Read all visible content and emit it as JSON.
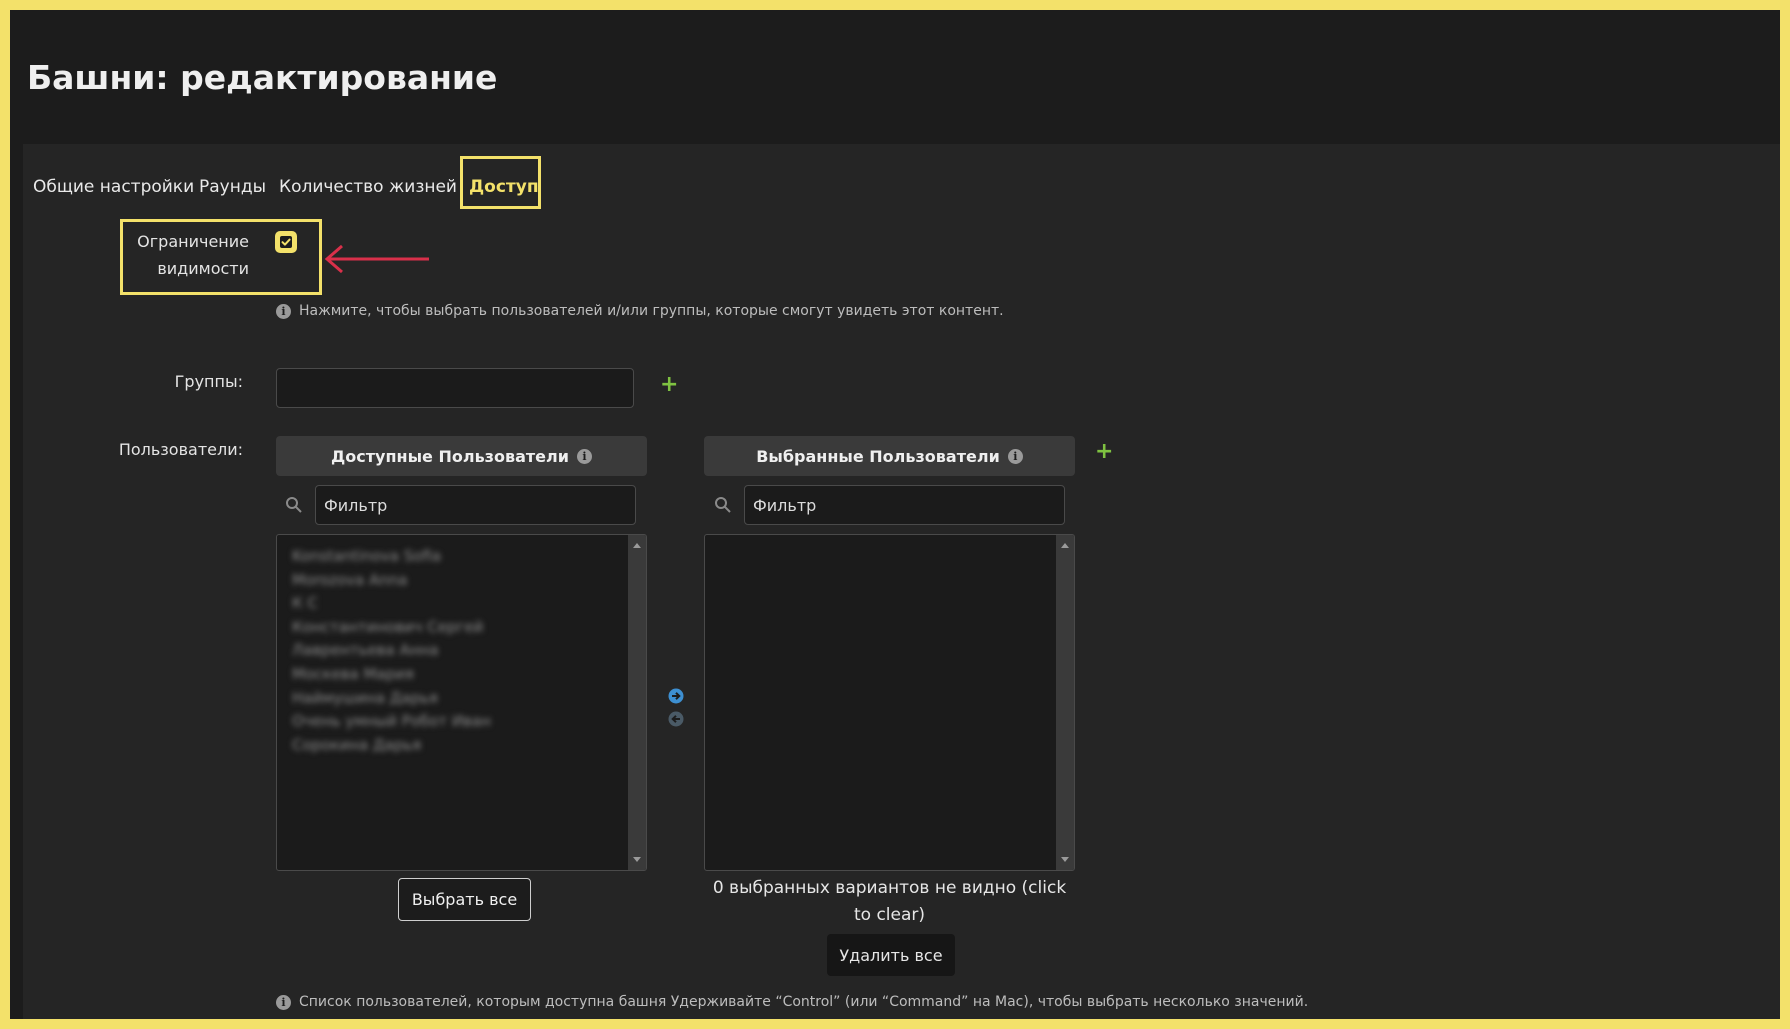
{
  "page": {
    "title": "Башни: редактирование"
  },
  "tabs": [
    {
      "label": "Общие настройки",
      "active": false
    },
    {
      "label": "Раунды",
      "active": false
    },
    {
      "label": "Количество жизней",
      "active": false
    },
    {
      "label": "Доступ",
      "active": true
    }
  ],
  "visibility": {
    "label": "Ограничение видимости",
    "checked": true,
    "help": "Нажмите, чтобы выбрать пользователей и/или группы, которые смогут увидеть этот контент."
  },
  "groups": {
    "label": "Группы:",
    "value": ""
  },
  "users": {
    "label": "Пользователи:",
    "available": {
      "title": "Доступные Пользователи",
      "filter_placeholder": "Фильтр",
      "items": [
        "Konstantinova Sofia",
        "Morozova Anna",
        "К С",
        "Константинович Сергей",
        "Лаврентьева Анна",
        "Москева Мария",
        "Наймушина Дарья",
        "Очень умный Робот Иван",
        "Сорокина Дарья"
      ],
      "select_all": "Выбрать все"
    },
    "selected": {
      "title": "Выбранные Пользователи",
      "filter_placeholder": "Фильтр",
      "items": [],
      "hidden_notice": "0 выбранных вариантов не видно (click to clear)",
      "remove_all": "Удалить все"
    },
    "help": "Список пользователей, которым доступна башня Удерживайте “Control” (или “Command” на Mac), чтобы выбрать несколько значений."
  },
  "colors": {
    "accent": "#f3e16a",
    "background": "#1c1c1c",
    "panel": "#252525",
    "add": "#7fc241",
    "annotation_arrow": "#d9304a",
    "move_arrow": "#3d8fd1"
  },
  "icons": {
    "info": "i",
    "add": "+",
    "search": "magnifier",
    "move_right": "circle-arrow-right",
    "move_left": "circle-arrow-left"
  }
}
